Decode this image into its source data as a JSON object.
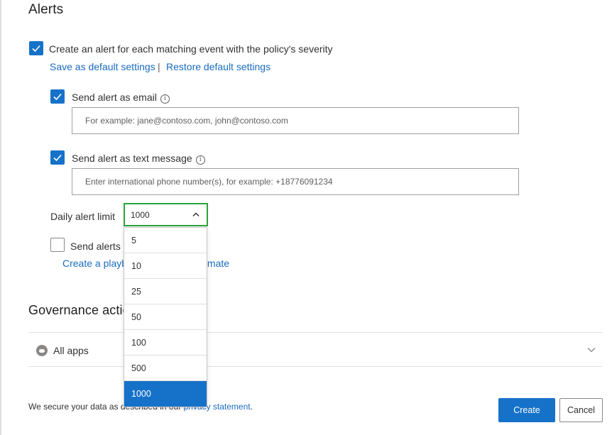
{
  "alerts": {
    "title": "Alerts",
    "create_alert_label": "Create an alert for each matching event with the policy's severity",
    "save_default_link": "Save as default settings",
    "separator": "|",
    "restore_default_link": "Restore default settings",
    "email": {
      "label": "Send alert as email",
      "placeholder": "For example: jane@contoso.com, john@contoso.com"
    },
    "text_message": {
      "label": "Send alert as text message",
      "placeholder": "Enter international phone number(s), for example: +18776091234"
    },
    "daily_limit": {
      "label": "Daily alert limit",
      "selected": "1000",
      "options": [
        "5",
        "10",
        "25",
        "50",
        "100",
        "500",
        "1000"
      ]
    },
    "send_alerts_label": "Send alerts to Power Automate",
    "playbook_link": "Create a playbook in Power Automate"
  },
  "governance": {
    "title": "Governance actions",
    "all_apps_label": "All apps"
  },
  "footer": {
    "text_before": "We secure your data as described in our ",
    "privacy_link": "privacy statement",
    "text_after": ".",
    "create_button": "Create",
    "cancel_button": "Cancel"
  },
  "colors": {
    "accent": "#1672c9",
    "focus_border": "#2aa33b",
    "link": "#1a6cc0"
  }
}
